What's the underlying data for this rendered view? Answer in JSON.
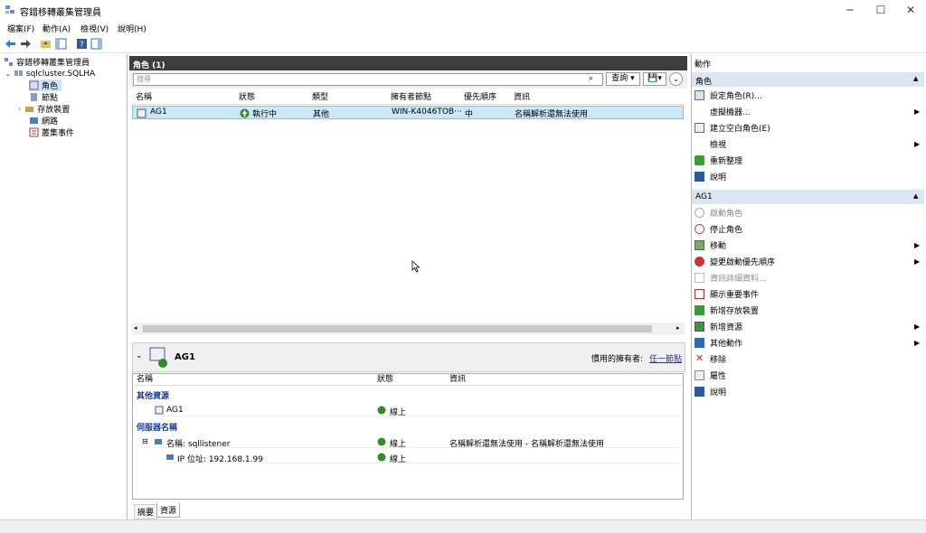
{
  "window": {
    "title": "容錯移轉叢集管理員"
  },
  "menu": [
    "檔案(F)",
    "動作(A)",
    "檢視(V)",
    "說明(H)"
  ],
  "tree": {
    "root": "容錯移轉叢集管理員",
    "cluster": "sqlcluster.SQLHA",
    "items": [
      "角色",
      "節點",
      "存放裝置",
      "網路",
      "叢集事件"
    ]
  },
  "roles": {
    "header": "角色 (1)",
    "search_placeholder": "搜尋",
    "query_label": "查詢",
    "columns": [
      "名稱",
      "狀態",
      "類型",
      "擁有者節點",
      "優先順序",
      "資訊"
    ],
    "rows": [
      {
        "name": "AG1",
        "status": "執行中",
        "type": "其他",
        "owner": "WIN-K4046TOB···",
        "priority": "中",
        "info": "名稱解析還無法使用"
      }
    ]
  },
  "detail": {
    "title": "AG1",
    "preferred_owner_label": "慣用的擁有者:",
    "preferred_owner_link": "任一節點",
    "columns": [
      "名稱",
      "狀態",
      "資訊"
    ],
    "group_other": "其他資源",
    "other_resource": {
      "name": "AG1",
      "status": "線上"
    },
    "group_server": "伺服器名稱",
    "server_name": {
      "name": "名稱: sqllistener",
      "status": "線上",
      "info": "名稱解析還無法使用 - 名稱解析還無法使用"
    },
    "ip": {
      "name": "IP 位址: 192.168.1.99",
      "status": "線上"
    },
    "tabs": [
      "摘要",
      "資源"
    ]
  },
  "actions": {
    "header": "動作",
    "section_roles": "角色",
    "role_items": [
      "設定角色(R)...",
      "虛擬機器...",
      "建立空白角色(E)",
      "檢視",
      "重新整理",
      "說明"
    ],
    "section_ag1": "AG1",
    "ag1_items": [
      "啟動角色",
      "停止角色",
      "移動",
      "變更啟動優先順序",
      "資訊詳細資料...",
      "顯示重要事件",
      "新增存放裝置",
      "新增資源",
      "其他動作",
      "移除",
      "屬性",
      "說明"
    ]
  }
}
